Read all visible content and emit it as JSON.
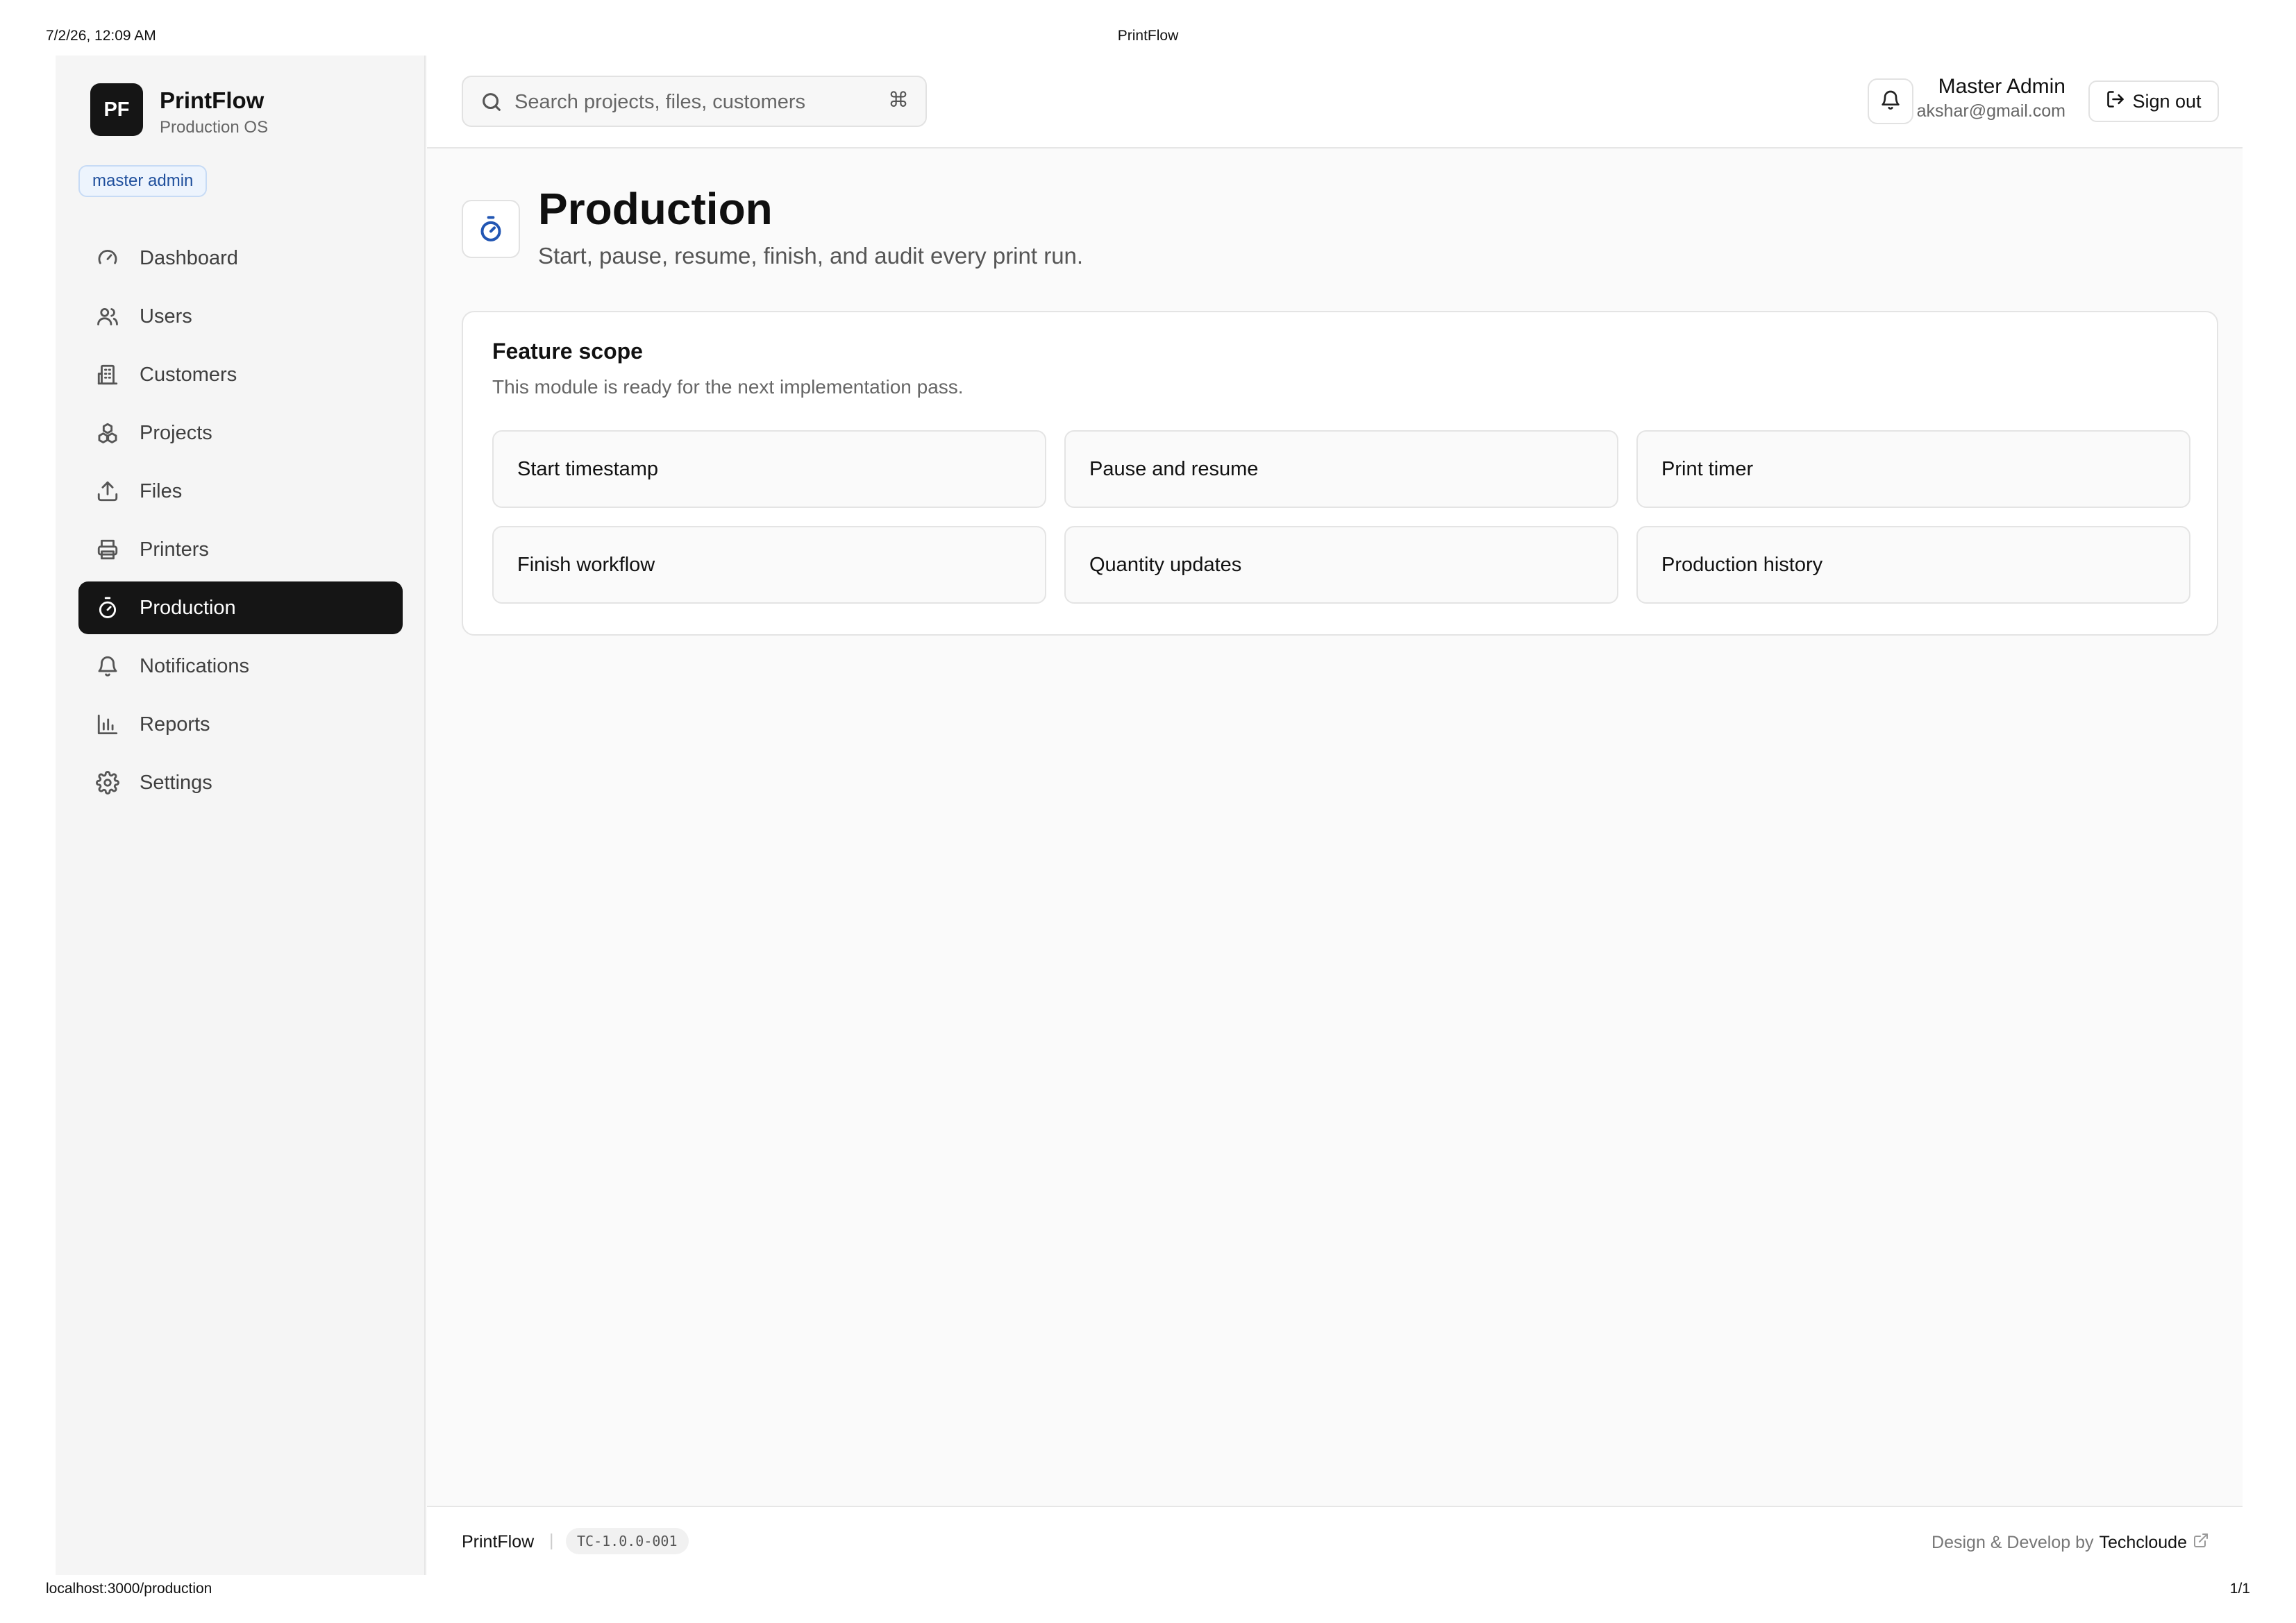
{
  "print": {
    "datetime": "7/2/26, 12:09 AM",
    "doc_title": "PrintFlow",
    "url": "localhost:3000/production",
    "page_count": "1/1"
  },
  "brand": {
    "logo_text": "PF",
    "name": "PrintFlow",
    "subtitle": "Production OS"
  },
  "role_badge": "master admin",
  "sidebar": {
    "items": [
      {
        "label": "Dashboard",
        "icon": "gauge-icon"
      },
      {
        "label": "Users",
        "icon": "users-icon"
      },
      {
        "label": "Customers",
        "icon": "building-icon"
      },
      {
        "label": "Projects",
        "icon": "boxes-icon"
      },
      {
        "label": "Files",
        "icon": "upload-icon"
      },
      {
        "label": "Printers",
        "icon": "printer-icon"
      },
      {
        "label": "Production",
        "icon": "timer-icon",
        "active": true
      },
      {
        "label": "Notifications",
        "icon": "bell-icon"
      },
      {
        "label": "Reports",
        "icon": "bar-chart-icon"
      },
      {
        "label": "Settings",
        "icon": "gear-icon"
      }
    ]
  },
  "topbar": {
    "search_placeholder": "Search projects, files, customers",
    "search_shortcut": "⌘",
    "user_name": "Master Admin",
    "user_email": "akshar@gmail.com",
    "sign_out_label": "Sign out"
  },
  "page": {
    "title": "Production",
    "subtitle": "Start, pause, resume, finish, and audit every print run."
  },
  "feature_scope": {
    "title": "Feature scope",
    "subtitle": "This module is ready for the next implementation pass.",
    "items": [
      "Start timestamp",
      "Pause and resume",
      "Print timer",
      "Finish workflow",
      "Quantity updates",
      "Production history"
    ]
  },
  "footer": {
    "brand": "PrintFlow",
    "separator": "|",
    "version": "TC-1.0.0-001",
    "credit_prefix": "Design & Develop by",
    "credit_name": "Techcloude"
  },
  "colors": {
    "accent": "#2256b3",
    "active_nav_bg": "#151515",
    "badge_bg": "#edf4fd",
    "badge_text": "#1f4f9c"
  }
}
